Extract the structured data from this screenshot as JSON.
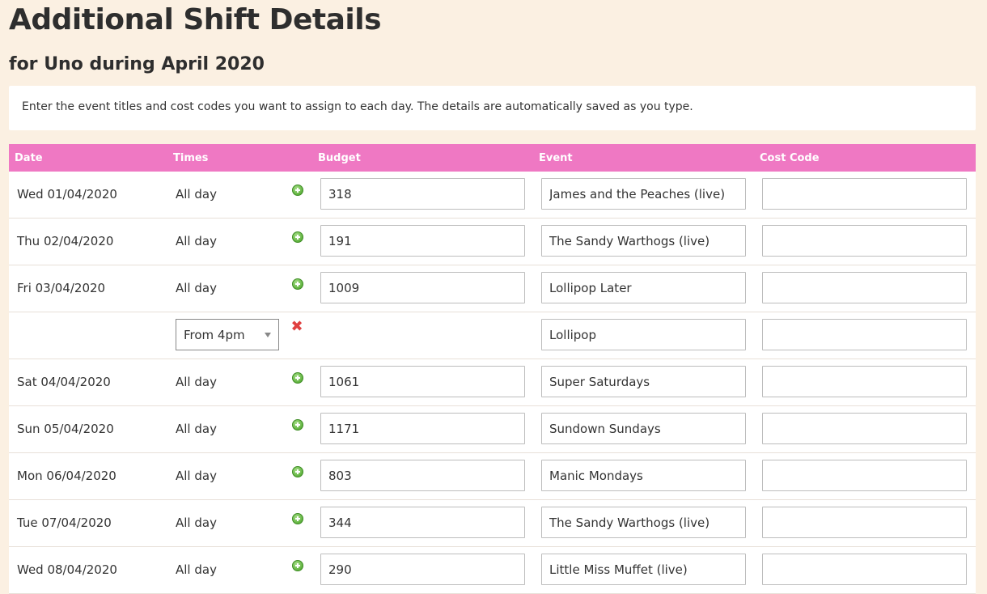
{
  "page": {
    "title": "Additional Shift Details",
    "subtitle": "for Uno during April 2020",
    "instructions": "Enter the event titles and cost codes you want to assign to each day. The details are automatically saved as you type."
  },
  "table": {
    "headers": {
      "date": "Date",
      "times": "Times",
      "budget": "Budget",
      "event": "Event",
      "cost_code": "Cost Code"
    },
    "rows": [
      {
        "date": "Wed 01/04/2020",
        "times": "All day",
        "budget": "318",
        "event": "James and the Peaches (live)",
        "cost_code": ""
      },
      {
        "date": "Thu 02/04/2020",
        "times": "All day",
        "budget": "191",
        "event": "The Sandy Warthogs (live)",
        "cost_code": ""
      },
      {
        "date": "Fri 03/04/2020",
        "times": "All day",
        "budget": "1009",
        "event": "Lollipop Later",
        "cost_code": ""
      },
      {
        "date": "",
        "times_select": "From 4pm",
        "event": "Lollipop",
        "cost_code": "",
        "sub_row": true
      },
      {
        "date": "Sat 04/04/2020",
        "times": "All day",
        "budget": "1061",
        "event": "Super Saturdays",
        "cost_code": ""
      },
      {
        "date": "Sun 05/04/2020",
        "times": "All day",
        "budget": "1171",
        "event": "Sundown Sundays",
        "cost_code": ""
      },
      {
        "date": "Mon 06/04/2020",
        "times": "All day",
        "budget": "803",
        "event": "Manic Mondays",
        "cost_code": ""
      },
      {
        "date": "Tue 07/04/2020",
        "times": "All day",
        "budget": "344",
        "event": "The Sandy Warthogs (live)",
        "cost_code": ""
      },
      {
        "date": "Wed 08/04/2020",
        "times": "All day",
        "budget": "290",
        "event": "Little Miss Muffet (live)",
        "cost_code": ""
      }
    ]
  },
  "icons": {
    "add": "plus-circle-icon",
    "remove": "cross-icon"
  },
  "colors": {
    "background": "#fbf0e2",
    "header": "#ef78c3",
    "add_icon": "#5fb23e",
    "remove_icon": "#e04040"
  }
}
